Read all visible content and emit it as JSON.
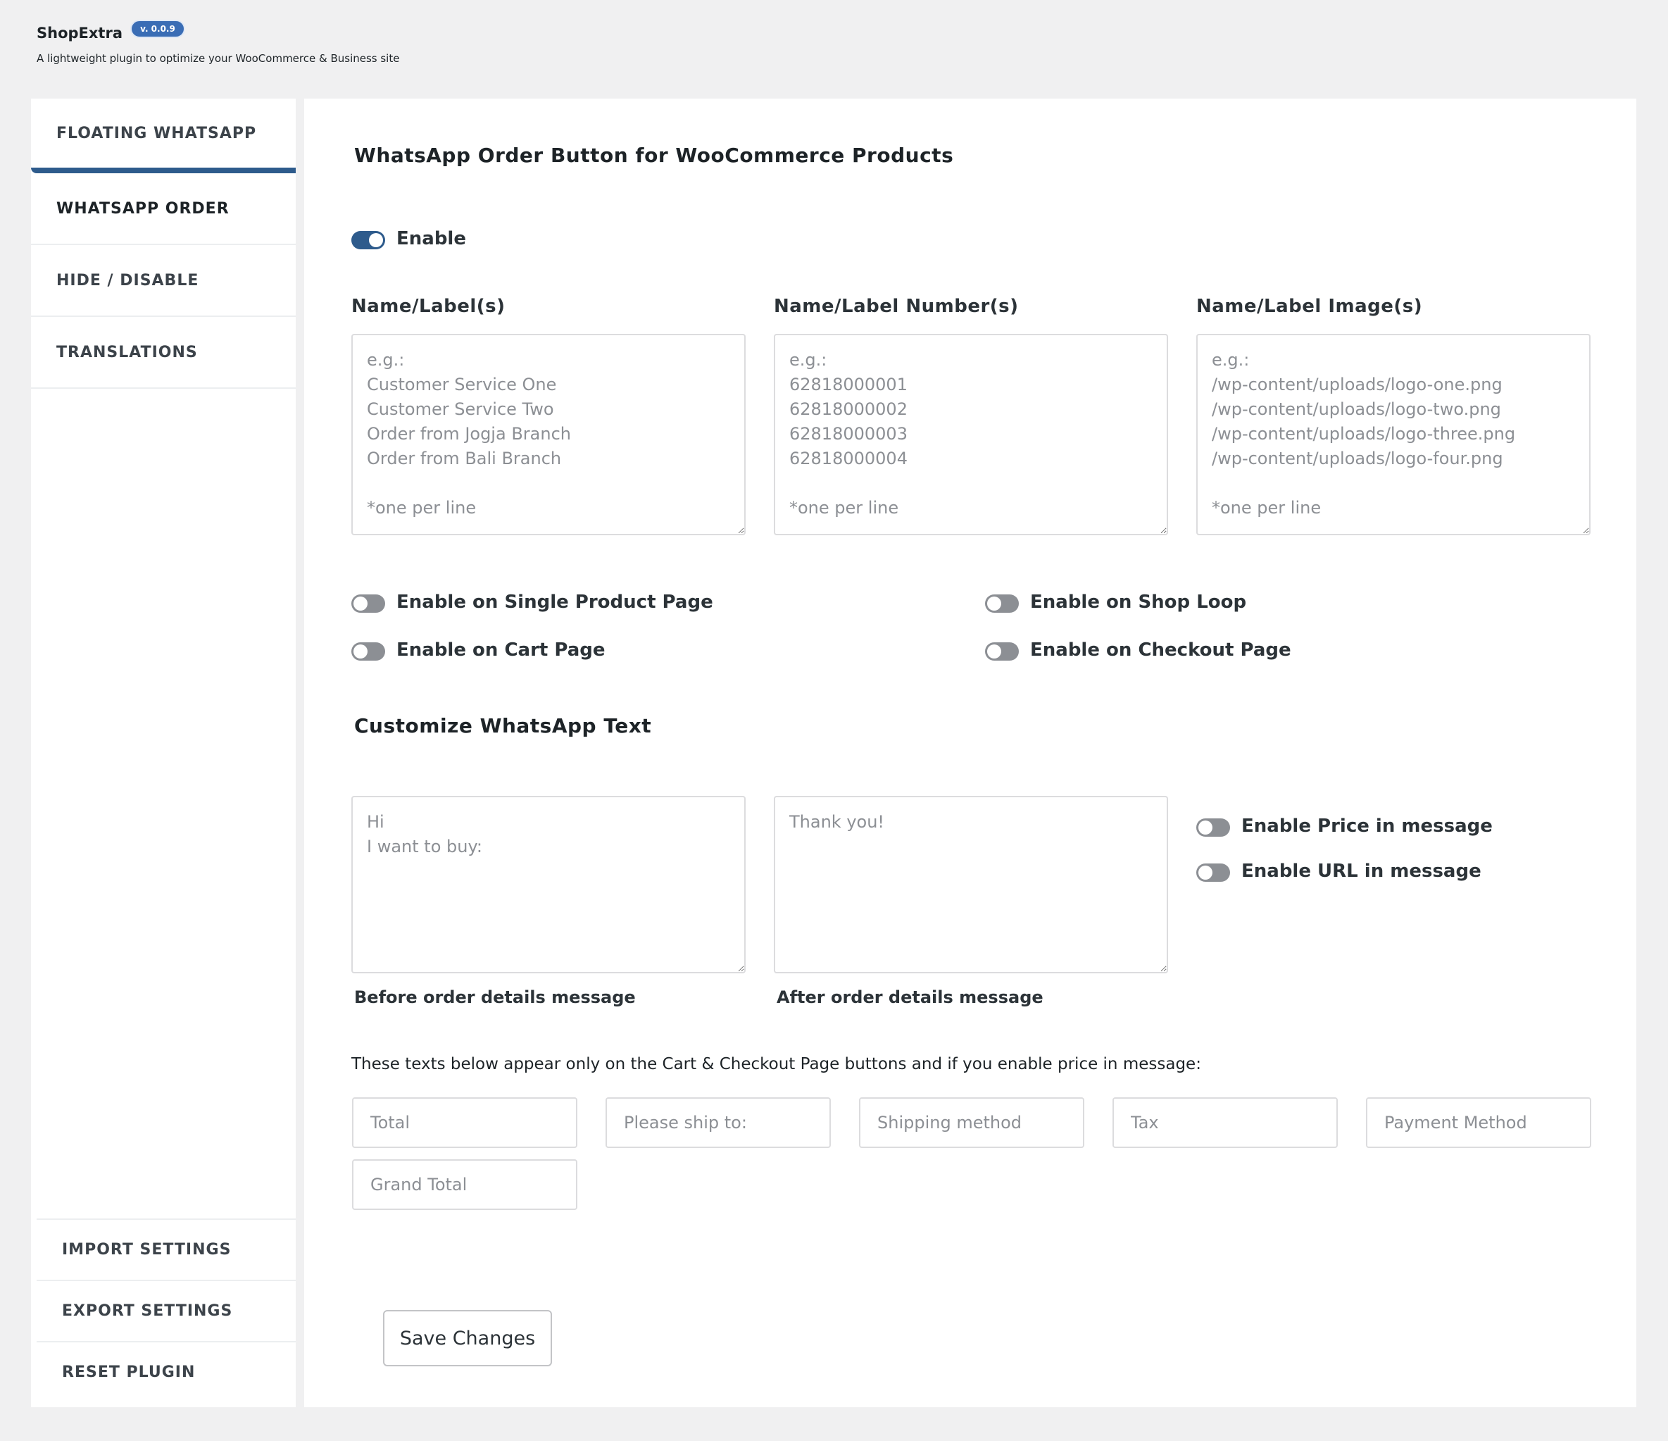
{
  "header": {
    "title": "ShopExtra",
    "version": "v. 0.0.9",
    "subtitle": "A lightweight plugin to optimize your WooCommerce & Business site"
  },
  "sidebar": {
    "items": [
      {
        "label": "FLOATING WHATSAPP"
      },
      {
        "label": "WHATSAPP ORDER"
      },
      {
        "label": "HIDE / DISABLE"
      },
      {
        "label": "TRANSLATIONS"
      }
    ],
    "bottom_items": [
      {
        "label": "IMPORT SETTINGS"
      },
      {
        "label": "EXPORT SETTINGS"
      },
      {
        "label": "RESET PLUGIN"
      }
    ]
  },
  "main": {
    "title": "WhatsApp Order Button for WooCommerce Products",
    "enable": {
      "label": "Enable",
      "on": true
    },
    "fields": [
      {
        "label": "Name/Label(s)",
        "placeholder": "e.g.:\nCustomer Service One\nCustomer Service Two\nOrder from Jogja Branch\nOrder from Bali Branch\n\n*one per line"
      },
      {
        "label": "Name/Label Number(s)",
        "placeholder": "e.g.:\n62818000001\n62818000002\n62818000003\n62818000004\n\n*one per line"
      },
      {
        "label": "Name/Label Image(s)",
        "placeholder": "e.g.:\n/wp-content/uploads/logo-one.png\n/wp-content/uploads/logo-two.png\n/wp-content/uploads/logo-three.png\n/wp-content/uploads/logo-four.png\n\n*one per line"
      }
    ],
    "toggles": [
      {
        "label": "Enable on Single Product Page",
        "on": false
      },
      {
        "label": "Enable on Shop Loop",
        "on": false
      },
      {
        "label": "Enable on Cart Page",
        "on": false
      },
      {
        "label": "Enable on Checkout Page",
        "on": false
      }
    ]
  },
  "customize": {
    "title": "Customize WhatsApp Text",
    "before": {
      "placeholder": "Hi\nI want to buy:",
      "caption": "Before order details message"
    },
    "after": {
      "placeholder": "Thank you!",
      "caption": "After order details message"
    },
    "toggles": [
      {
        "label": "Enable Price in message",
        "on": false
      },
      {
        "label": "Enable URL in message",
        "on": false
      }
    ],
    "note": "These texts below appear only on the Cart & Checkout Page buttons and if you enable price in message:",
    "inputs": [
      {
        "placeholder": "Total"
      },
      {
        "placeholder": "Please ship to:"
      },
      {
        "placeholder": "Shipping method"
      },
      {
        "placeholder": "Tax"
      },
      {
        "placeholder": "Payment Method"
      },
      {
        "placeholder": "Grand Total"
      }
    ]
  },
  "save_label": "Save Changes",
  "colors": {
    "accent": "#2e5b8c",
    "badge": "#3a6db5",
    "background": "#f0f0f1"
  }
}
